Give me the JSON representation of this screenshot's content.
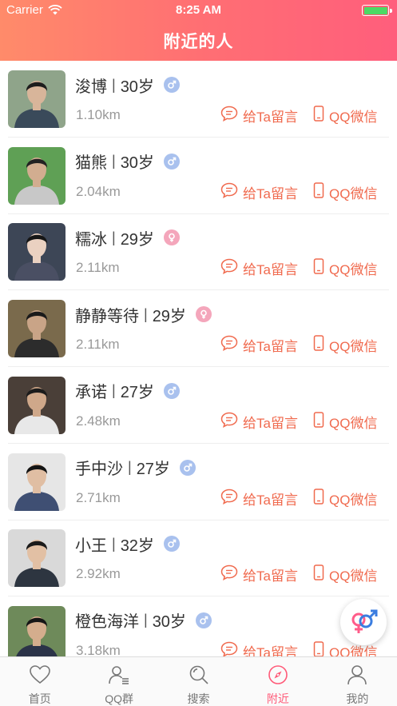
{
  "status_bar": {
    "carrier": "Carrier",
    "time": "8:25 AM"
  },
  "header": {
    "title": "附近的人"
  },
  "actions": {
    "message_label": "给Ta留言",
    "qq_label": "QQ微信"
  },
  "colors": {
    "accent": "#ff6f73",
    "action": "#f06a4e",
    "male": "#a9c1ee",
    "female": "#f4a6bb",
    "tab_active": "#ff5a78"
  },
  "people": [
    {
      "name": "浚博",
      "age": "30岁",
      "gender": "male",
      "distance": "1.10km",
      "avatar": {
        "bg": "#8fa48a",
        "shirt": "#3a4a5a",
        "hair": "#1d1d1d",
        "skin": "#d8b59a"
      }
    },
    {
      "name": "猫熊",
      "age": "30岁",
      "gender": "male",
      "distance": "2.04km",
      "avatar": {
        "bg": "#5fa055",
        "shirt": "#c8c8c8",
        "hair": "#222222",
        "skin": "#d2ad90"
      }
    },
    {
      "name": "糯冰",
      "age": "29岁",
      "gender": "female",
      "distance": "2.11km",
      "avatar": {
        "bg": "#3d4656",
        "shirt": "#4a4f63",
        "hair": "#161616",
        "skin": "#ead1c1"
      }
    },
    {
      "name": "静静等待",
      "age": "29岁",
      "gender": "female",
      "distance": "2.11km",
      "avatar": {
        "bg": "#7a6a4c",
        "shirt": "#2c2c2c",
        "hair": "#1a1a1a",
        "skin": "#c9a487"
      }
    },
    {
      "name": "承诺",
      "age": "27岁",
      "gender": "male",
      "distance": "2.48km",
      "avatar": {
        "bg": "#4a3f38",
        "shirt": "#e8e8e8",
        "hair": "#1b1b1b",
        "skin": "#cfa88a"
      }
    },
    {
      "name": "手中沙",
      "age": "27岁",
      "gender": "male",
      "distance": "2.71km",
      "avatar": {
        "bg": "#e6e6e6",
        "shirt": "#3f4f73",
        "hair": "#141414",
        "skin": "#e0bea3"
      }
    },
    {
      "name": "小王",
      "age": "32岁",
      "gender": "male",
      "distance": "2.92km",
      "avatar": {
        "bg": "#d9d9d9",
        "shirt": "#2d3540",
        "hair": "#1a1a1a",
        "skin": "#e2c0a4"
      }
    },
    {
      "name": "橙色海洋",
      "age": "30岁",
      "gender": "male",
      "distance": "3.18km",
      "avatar": {
        "bg": "#6e8a5a",
        "shirt": "#2b3348",
        "hair": "#161616",
        "skin": "#d4ad8d"
      }
    }
  ],
  "tabs": [
    {
      "label": "首页",
      "icon": "heart-icon",
      "active": false
    },
    {
      "label": "QQ群",
      "icon": "group-icon",
      "active": false
    },
    {
      "label": "搜索",
      "icon": "search-icon",
      "active": false
    },
    {
      "label": "附近",
      "icon": "compass-icon",
      "active": true
    },
    {
      "label": "我的",
      "icon": "profile-icon",
      "active": false
    }
  ],
  "fab": {
    "icon": "gender-filter-icon"
  }
}
